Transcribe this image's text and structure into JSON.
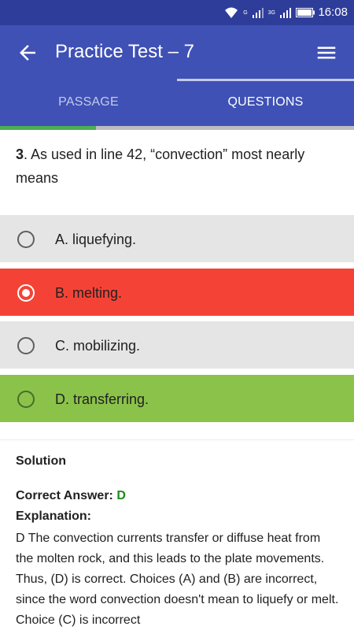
{
  "status_bar": {
    "time": "16:08",
    "net_label_1": "G",
    "net_label_2": "3G"
  },
  "app_bar": {
    "title": "Practice Test – 7",
    "back_icon": "arrow-left-icon",
    "menu_icon": "hamburger-menu-icon"
  },
  "tabs": [
    {
      "label": "PASSAGE",
      "selected": false
    },
    {
      "label": "QUESTIONS",
      "selected": true
    }
  ],
  "progress": {
    "fraction": 0.27,
    "color": "#4caf50"
  },
  "question": {
    "number": "3",
    "text": ". As used in line 42, “convection” most nearly means"
  },
  "options": [
    {
      "label": "A. liquefying.",
      "state": "neutral",
      "bg": "#e5e5e5"
    },
    {
      "label": "B. melting.",
      "state": "selected-wrong",
      "bg": "#f44336"
    },
    {
      "label": "C. mobilizing.",
      "state": "neutral",
      "bg": "#e5e5e5"
    },
    {
      "label": "D. transferring.",
      "state": "correct",
      "bg": "#8bc34a"
    }
  ],
  "solution": {
    "title": "Solution",
    "correct_label": "Correct Answer: ",
    "correct_value": "D",
    "explanation_label": "Explanation:",
    "explanation_text": "D The convection currents transfer or diffuse heat from the molten rock, and this leads to the plate movements. Thus, (D) is correct. Choices (A) and (B) are incorrect, since the word convection doesn't mean to liquefy or melt. Choice (C) is incorrect"
  }
}
